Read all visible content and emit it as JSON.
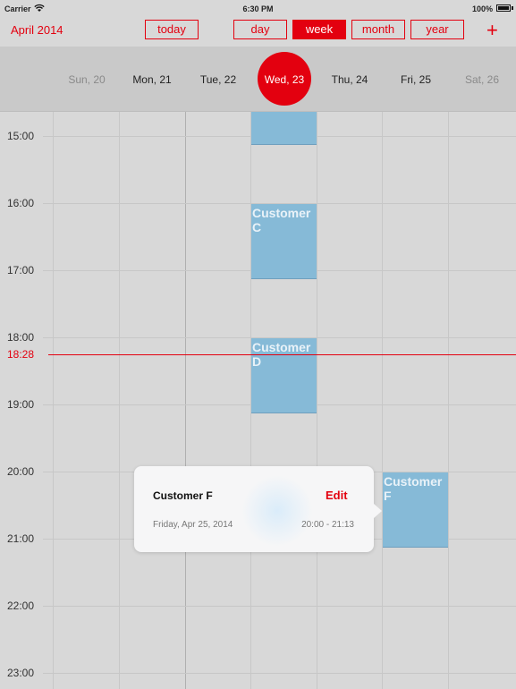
{
  "status_bar": {
    "carrier": "Carrier",
    "wifi_icon": "wifi-icon",
    "time": "6:30 PM",
    "battery": "100%",
    "battery_icon": "battery-icon"
  },
  "toolbar": {
    "month_title": "April 2014",
    "today_label": "today",
    "views": [
      "day",
      "week",
      "month",
      "year"
    ],
    "active_view": "week",
    "add_label": "+"
  },
  "days": [
    {
      "label": "Sun, 20",
      "weekend": true
    },
    {
      "label": "Mon, 21",
      "weekend": false
    },
    {
      "label": "Tue, 22",
      "weekend": false
    },
    {
      "label": "Wed, 23",
      "weekend": false,
      "today": true
    },
    {
      "label": "Thu, 24",
      "weekend": false
    },
    {
      "label": "Fri, 25",
      "weekend": false
    },
    {
      "label": "Sat, 26",
      "weekend": true
    }
  ],
  "hours": [
    "15:00",
    "16:00",
    "17:00",
    "18:00",
    "19:00",
    "20:00",
    "21:00",
    "22:00",
    "23:00"
  ],
  "current_time": "18:28",
  "events": [
    {
      "title": "",
      "day": "Wed, 23",
      "start": "14:30",
      "end": "15:08"
    },
    {
      "title": "Customer C",
      "day": "Wed, 23",
      "start": "16:00",
      "end": "17:08"
    },
    {
      "title": "Customer D",
      "day": "Wed, 23",
      "start": "18:00",
      "end": "19:08"
    },
    {
      "title": "Customer F",
      "day": "Fri, 25",
      "start": "20:00",
      "end": "21:08"
    }
  ],
  "popover": {
    "title": "Customer F",
    "edit_label": "Edit",
    "date": "Friday, Apr 25, 2014",
    "time_range": "20:00 - 21:13"
  },
  "colors": {
    "accent": "#e3000f",
    "event": "#86bad7",
    "background": "#d8d8d8"
  }
}
